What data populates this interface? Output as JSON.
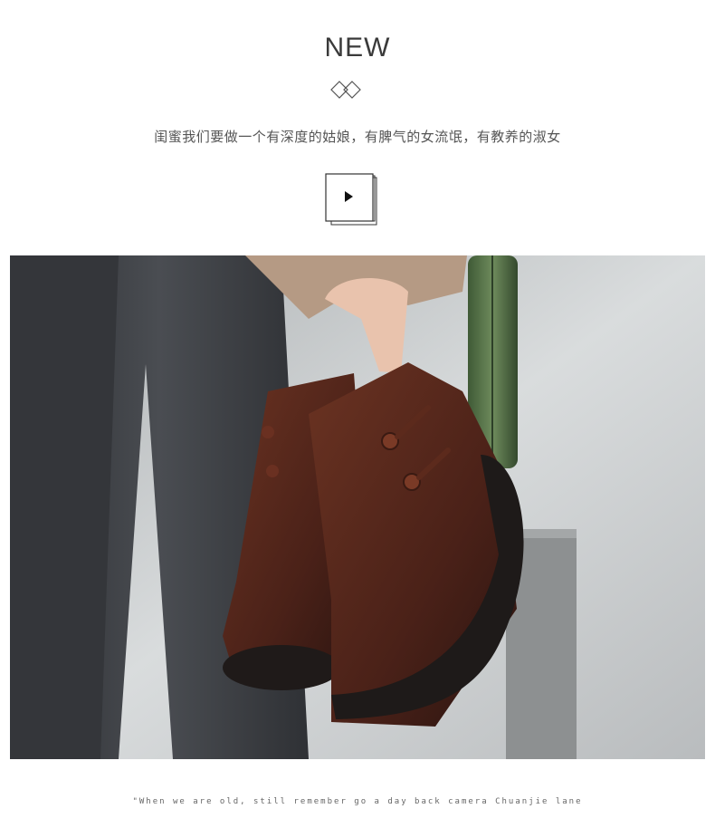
{
  "header": {
    "title": "NEW",
    "tagline": "闺蜜我们要做一个有深度的姑娘，有脾气的女流氓，有教养的淑女"
  },
  "icons": {
    "ornament": "double-diamond-icon",
    "play": "play-icon"
  },
  "photo": {
    "subject": "product-photo"
  },
  "footer": {
    "quote": "\"When we are old, still remember go a day back camera Chuanjie lane"
  },
  "colors": {
    "text": "#3a3a3a",
    "leather": "#5a2a1e",
    "sole": "#1e1a19",
    "jeans": "#3d3f43",
    "wall": "#cfd2d3"
  }
}
